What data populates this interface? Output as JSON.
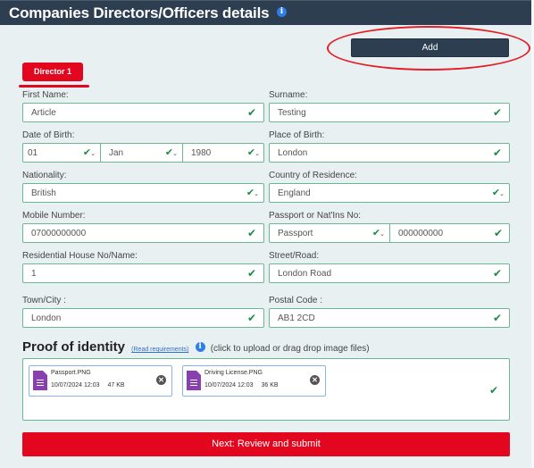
{
  "header": {
    "title": "Companies Directors/Officers details",
    "info_icon": "info-circle-icon"
  },
  "toolbar": {
    "add_label": "Add"
  },
  "director_tabs": [
    {
      "label": "Director 1",
      "active": true
    }
  ],
  "form": {
    "first_name": {
      "label": "First Name:",
      "value": "Article",
      "valid": true
    },
    "surname": {
      "label": "Surname:",
      "value": "Testing",
      "valid": true
    },
    "dob": {
      "label": "Date of Birth:",
      "day": "01",
      "month": "Jan",
      "year": "1980",
      "valid": true
    },
    "place_of_birth": {
      "label": "Place of Birth:",
      "value": "London",
      "valid": true
    },
    "nationality": {
      "label": "Nationality:",
      "value": "British",
      "valid": true
    },
    "country_of_residence": {
      "label": "Country of Residence:",
      "value": "England",
      "valid": true
    },
    "mobile": {
      "label": "Mobile Number:",
      "value": "07000000000",
      "valid": true
    },
    "passport": {
      "label": "Passport or Nat'Ins No:",
      "type": "Passport",
      "number": "000000000",
      "valid": true
    },
    "house": {
      "label": "Residential House No/Name:",
      "value": "1",
      "valid": true
    },
    "street": {
      "label": "Street/Road:",
      "value": "London Road",
      "valid": true
    },
    "town": {
      "label": "Town/City :",
      "value": "London",
      "valid": true
    },
    "postal_code": {
      "label": "Postal Code :",
      "value": "AB1 2CD",
      "valid": true
    }
  },
  "proof": {
    "title": "Proof of identity",
    "link": "(Read requirements)",
    "hint": "(click to upload or drag drop image files)",
    "files": [
      {
        "name": "Passport.PNG",
        "date": "10/07/2024 12:03",
        "size": "47 KB"
      },
      {
        "name": "Driving License.PNG",
        "date": "10/07/2024 12:03",
        "size": "36 KB"
      }
    ]
  },
  "icons": {
    "check": "✔",
    "chevron": "⌄",
    "remove": "✕",
    "info": "i"
  },
  "footer": {
    "next_label": "Next: Review and submit"
  },
  "colors": {
    "header": "#2d3e50",
    "accent_red": "#e2061f",
    "valid_green": "#1e8a45",
    "file_purple": "#8a3fb0",
    "info_blue": "#2e7ee8"
  }
}
